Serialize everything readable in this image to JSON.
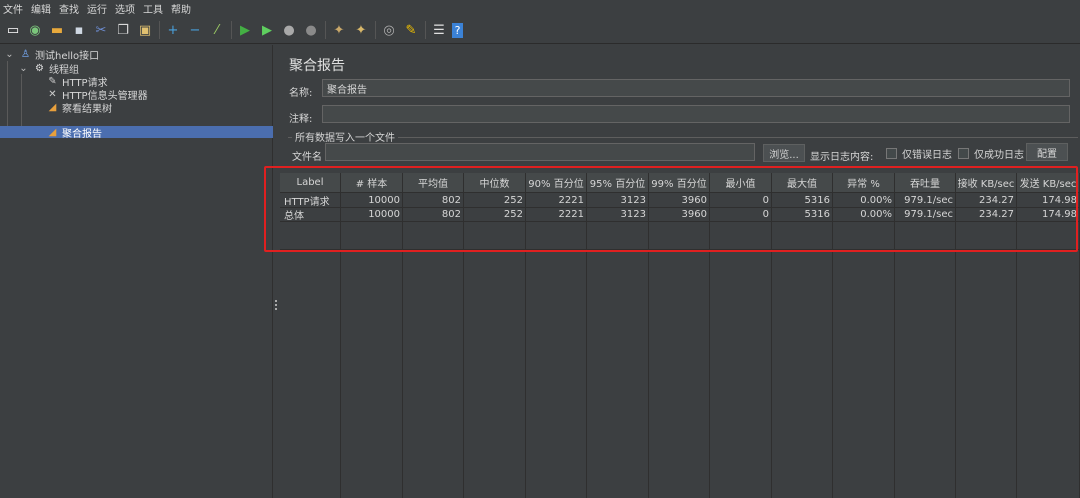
{
  "menu": [
    "文件",
    "编辑",
    "查找",
    "运行",
    "选项",
    "工具",
    "帮助"
  ],
  "toolbar": [
    {
      "name": "new-icon",
      "glyph": "▭",
      "color": "#ffffff"
    },
    {
      "name": "templates-icon",
      "glyph": "◉",
      "color": "#7bc67b"
    },
    {
      "name": "open-icon",
      "glyph": "▬",
      "color": "#e8a93c"
    },
    {
      "name": "save-icon",
      "glyph": "▪",
      "color": "#cfd8e3"
    },
    {
      "name": "cut-icon",
      "glyph": "✂",
      "color": "#6f8fd6"
    },
    {
      "name": "copy-icon",
      "glyph": "❐",
      "color": "#d9d9d9"
    },
    {
      "name": "paste-icon",
      "glyph": "▣",
      "color": "#e0c070"
    },
    {
      "name": "expand-icon",
      "glyph": "+",
      "color": "#4aa3df"
    },
    {
      "name": "collapse-icon",
      "glyph": "−",
      "color": "#4aa3df"
    },
    {
      "name": "toggle-icon",
      "glyph": "⁄",
      "color": "#9ccc65"
    },
    {
      "name": "start-icon",
      "glyph": "▶",
      "color": "#44b044"
    },
    {
      "name": "start-no-pause-icon",
      "glyph": "▶",
      "color": "#5fcf5f"
    },
    {
      "name": "stop-icon",
      "glyph": "●",
      "color": "#a9a9a9"
    },
    {
      "name": "shutdown-icon",
      "glyph": "●",
      "color": "#8a8a8a"
    },
    {
      "name": "clear-icon",
      "glyph": "✦",
      "color": "#c9a86a"
    },
    {
      "name": "clear-all-icon",
      "glyph": "✦",
      "color": "#d9b86a"
    },
    {
      "name": "search-icon",
      "glyph": "◎",
      "color": "#b0b0b0"
    },
    {
      "name": "reset-search-icon",
      "glyph": "✎",
      "color": "#f0c000"
    },
    {
      "name": "function-helper-icon",
      "glyph": "☰",
      "color": "#e0e0e0"
    },
    {
      "name": "help-icon",
      "glyph": "?",
      "color": "#3b82d6"
    }
  ],
  "tree": {
    "root": "测试hello接口",
    "thread_group": "线程组",
    "items": [
      "HTTP请求",
      "HTTP信息头管理器",
      "察看结果树",
      "聚合报告"
    ],
    "selected": "聚合报告"
  },
  "panel": {
    "title": "聚合报告",
    "name_label": "名称:",
    "name_value": "聚合报告",
    "comment_label": "注释:",
    "comment_value": "",
    "group_label": "所有数据写入一个文件",
    "filename_label": "文件名",
    "filename_value": "",
    "browse_label": "浏览...",
    "log_label": "显示日志内容:",
    "errors_only_label": "仅错误日志",
    "success_only_label": "仅成功日志",
    "configure_label": "配置"
  },
  "table": {
    "headers": [
      "Label",
      "# 样本",
      "平均值",
      "中位数",
      "90% 百分位",
      "95% 百分位",
      "99% 百分位",
      "最小值",
      "最大值",
      "异常 %",
      "吞吐量",
      "接收 KB/sec",
      "发送 KB/sec"
    ],
    "rows": [
      [
        "HTTP请求",
        "10000",
        "802",
        "252",
        "2221",
        "3123",
        "3960",
        "0",
        "5316",
        "0.00%",
        "979.1/sec",
        "234.27",
        "174.98"
      ],
      [
        "总体",
        "10000",
        "802",
        "252",
        "2221",
        "3123",
        "3960",
        "0",
        "5316",
        "0.00%",
        "979.1/sec",
        "234.27",
        "174.98"
      ]
    ]
  },
  "colors": {
    "highlight_box": "#e02020",
    "selection": "#4b6eaf"
  }
}
